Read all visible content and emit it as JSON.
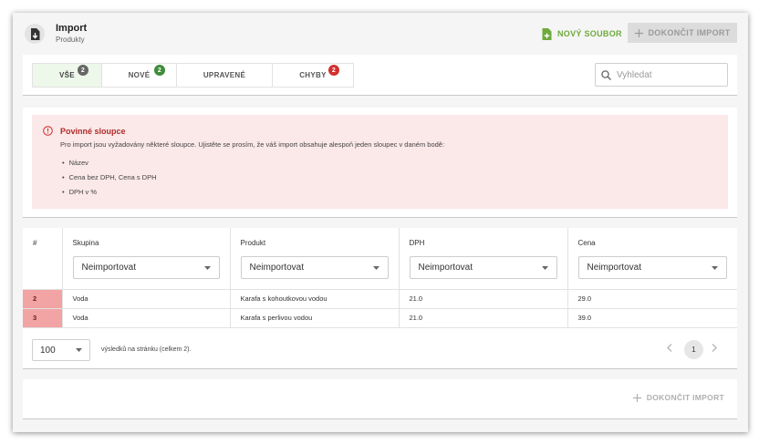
{
  "header": {
    "title": "Import",
    "subtitle": "Produkty",
    "new_file_label": "NOVÝ SOUBOR",
    "finish_label": "DOKONČIT IMPORT"
  },
  "tabs": [
    {
      "label": "VŠE",
      "badge": "2",
      "badge_color": "#666666",
      "active": true
    },
    {
      "label": "NOVÉ",
      "badge": "2",
      "badge_color": "#3d8c3a",
      "active": false
    },
    {
      "label": "UPRAVENÉ",
      "badge": "",
      "active": false
    },
    {
      "label": "CHYBY",
      "badge": "2",
      "badge_color": "#d32f2f",
      "active": false
    }
  ],
  "search": {
    "placeholder": "Vyhledat"
  },
  "alert": {
    "title": "Povinné sloupce",
    "text": "Pro import jsou vyžadovány některé sloupce. Ujistěte se prosím, že váš import obsahuje alespoň jeden sloupec v daném bodě:",
    "items": [
      "Název",
      "Cena bez DPH, Cena s DPH",
      "DPH v %"
    ]
  },
  "table": {
    "hash": "#",
    "columns": [
      {
        "label": "Skupina",
        "select": "Neimportovat"
      },
      {
        "label": "Produkt",
        "select": "Neimportovat"
      },
      {
        "label": "DPH",
        "select": "Neimportovat"
      },
      {
        "label": "Cena",
        "select": "Neimportovat"
      }
    ],
    "rows": [
      {
        "num": "2",
        "cells": [
          "Voda",
          "Karafa s kohoutkovou vodou",
          "21.0",
          "29.0"
        ]
      },
      {
        "num": "3",
        "cells": [
          "Voda",
          "Karafa s perlivou vodou",
          "21.0",
          "39.0"
        ]
      }
    ]
  },
  "pagination": {
    "per_page": "100",
    "text": "výsledků na stránku (celkem 2).",
    "current_page": "1"
  },
  "footer": {
    "finish_label": "DOKONČIT IMPORT"
  },
  "colors": {
    "accent_green": "#6eaa3c",
    "error_red": "#d32f2f",
    "alert_bg": "#fbe8e8",
    "row_error": "#f2a3a3"
  }
}
